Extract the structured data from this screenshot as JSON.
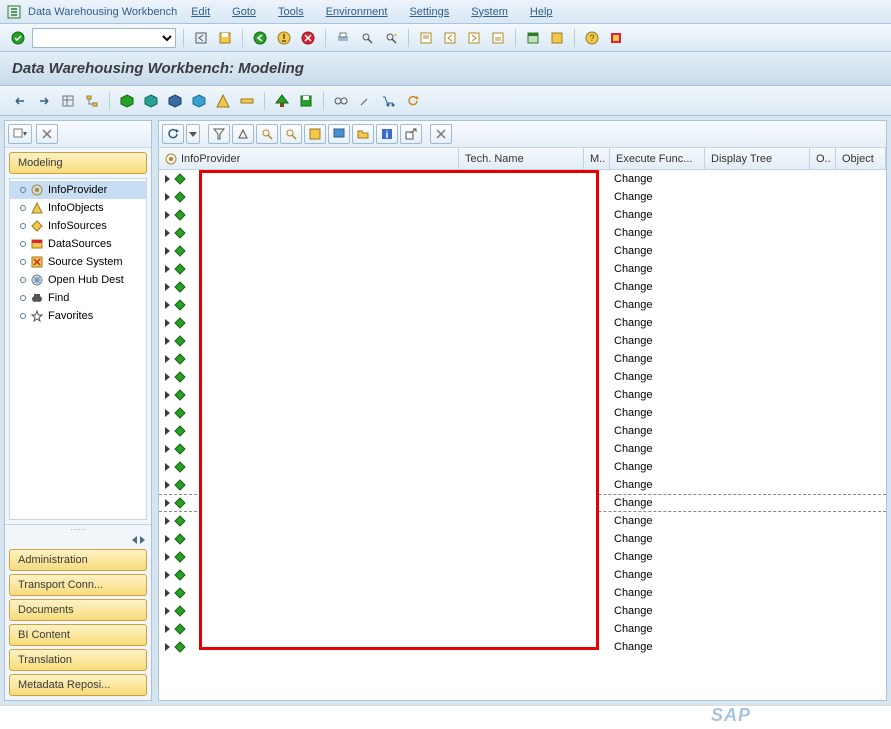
{
  "menu": {
    "title": "Data Warehousing Workbench",
    "items": [
      "Edit",
      "Goto",
      "Tools",
      "Environment",
      "Settings",
      "System",
      "Help"
    ]
  },
  "title": "Data Warehousing Workbench: Modeling",
  "sidebar": {
    "heading": "Modeling",
    "tree": [
      {
        "label": "InfoProvider",
        "icon": "target",
        "selected": true
      },
      {
        "label": "InfoObjects",
        "icon": "triangle",
        "selected": false
      },
      {
        "label": "InfoSources",
        "icon": "diamond-y",
        "selected": false
      },
      {
        "label": "DataSources",
        "icon": "datasource",
        "selected": false
      },
      {
        "label": "Source System",
        "icon": "square-x",
        "selected": false
      },
      {
        "label": "Open Hub Dest",
        "icon": "asterisk",
        "selected": false
      },
      {
        "label": "Find",
        "icon": "binoculars",
        "selected": false
      },
      {
        "label": "Favorites",
        "icon": "favorites",
        "selected": false
      }
    ],
    "bottom": [
      "Administration",
      "Transport Conn...",
      "Documents",
      "BI Content",
      "Translation",
      "Metadata Reposi..."
    ]
  },
  "grid": {
    "columns": [
      "InfoProvider",
      "Tech. Name",
      "M..",
      "Execute Func...",
      "Display Tree",
      "O..",
      "Object"
    ],
    "rows": [
      {
        "exec": "Change",
        "dashed": false
      },
      {
        "exec": "Change",
        "dashed": false
      },
      {
        "exec": "Change",
        "dashed": false
      },
      {
        "exec": "Change",
        "dashed": false
      },
      {
        "exec": "Change",
        "dashed": false
      },
      {
        "exec": "Change",
        "dashed": false
      },
      {
        "exec": "Change",
        "dashed": false
      },
      {
        "exec": "Change",
        "dashed": false
      },
      {
        "exec": "Change",
        "dashed": false
      },
      {
        "exec": "Change",
        "dashed": false
      },
      {
        "exec": "Change",
        "dashed": false
      },
      {
        "exec": "Change",
        "dashed": false
      },
      {
        "exec": "Change",
        "dashed": false
      },
      {
        "exec": "Change",
        "dashed": false
      },
      {
        "exec": "Change",
        "dashed": false
      },
      {
        "exec": "Change",
        "dashed": false
      },
      {
        "exec": "Change",
        "dashed": false
      },
      {
        "exec": "Change",
        "dashed": false
      },
      {
        "exec": "Change",
        "dashed": true
      },
      {
        "exec": "Change",
        "dashed": false
      },
      {
        "exec": "Change",
        "dashed": false
      },
      {
        "exec": "Change",
        "dashed": false
      },
      {
        "exec": "Change",
        "dashed": false
      },
      {
        "exec": "Change",
        "dashed": false
      },
      {
        "exec": "Change",
        "dashed": false
      },
      {
        "exec": "Change",
        "dashed": false
      },
      {
        "exec": "Change",
        "dashed": false
      }
    ]
  },
  "footer": {
    "logo": "SAP"
  }
}
